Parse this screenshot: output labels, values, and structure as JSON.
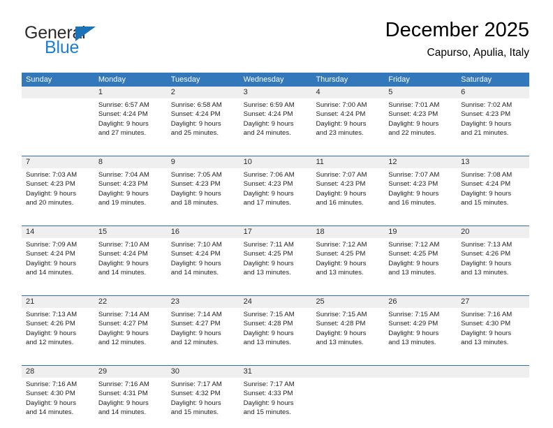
{
  "logo": {
    "word_top": "General",
    "word_bottom": "Blue",
    "triangle_color": "#1b72b8",
    "blue_text_color": "#1a7fd4"
  },
  "header": {
    "title": "December 2025",
    "subtitle": "Capurso, Apulia, Italy"
  },
  "theme": {
    "header_row_bg": "#3378bb",
    "week_divider": "#2f6fae",
    "day_number_bg": "#efefef"
  },
  "weekdays": [
    "Sunday",
    "Monday",
    "Tuesday",
    "Wednesday",
    "Thursday",
    "Friday",
    "Saturday"
  ],
  "weeks": [
    [
      {
        "day": "",
        "empty": true
      },
      {
        "day": "1",
        "sunrise": "Sunrise: 6:57 AM",
        "sunset": "Sunset: 4:24 PM",
        "daylight_1": "Daylight: 9 hours",
        "daylight_2": "and 27 minutes."
      },
      {
        "day": "2",
        "sunrise": "Sunrise: 6:58 AM",
        "sunset": "Sunset: 4:24 PM",
        "daylight_1": "Daylight: 9 hours",
        "daylight_2": "and 25 minutes."
      },
      {
        "day": "3",
        "sunrise": "Sunrise: 6:59 AM",
        "sunset": "Sunset: 4:24 PM",
        "daylight_1": "Daylight: 9 hours",
        "daylight_2": "and 24 minutes."
      },
      {
        "day": "4",
        "sunrise": "Sunrise: 7:00 AM",
        "sunset": "Sunset: 4:24 PM",
        "daylight_1": "Daylight: 9 hours",
        "daylight_2": "and 23 minutes."
      },
      {
        "day": "5",
        "sunrise": "Sunrise: 7:01 AM",
        "sunset": "Sunset: 4:23 PM",
        "daylight_1": "Daylight: 9 hours",
        "daylight_2": "and 22 minutes."
      },
      {
        "day": "6",
        "sunrise": "Sunrise: 7:02 AM",
        "sunset": "Sunset: 4:23 PM",
        "daylight_1": "Daylight: 9 hours",
        "daylight_2": "and 21 minutes."
      }
    ],
    [
      {
        "day": "7",
        "sunrise": "Sunrise: 7:03 AM",
        "sunset": "Sunset: 4:23 PM",
        "daylight_1": "Daylight: 9 hours",
        "daylight_2": "and 20 minutes."
      },
      {
        "day": "8",
        "sunrise": "Sunrise: 7:04 AM",
        "sunset": "Sunset: 4:23 PM",
        "daylight_1": "Daylight: 9 hours",
        "daylight_2": "and 19 minutes."
      },
      {
        "day": "9",
        "sunrise": "Sunrise: 7:05 AM",
        "sunset": "Sunset: 4:23 PM",
        "daylight_1": "Daylight: 9 hours",
        "daylight_2": "and 18 minutes."
      },
      {
        "day": "10",
        "sunrise": "Sunrise: 7:06 AM",
        "sunset": "Sunset: 4:23 PM",
        "daylight_1": "Daylight: 9 hours",
        "daylight_2": "and 17 minutes."
      },
      {
        "day": "11",
        "sunrise": "Sunrise: 7:07 AM",
        "sunset": "Sunset: 4:23 PM",
        "daylight_1": "Daylight: 9 hours",
        "daylight_2": "and 16 minutes."
      },
      {
        "day": "12",
        "sunrise": "Sunrise: 7:07 AM",
        "sunset": "Sunset: 4:23 PM",
        "daylight_1": "Daylight: 9 hours",
        "daylight_2": "and 16 minutes."
      },
      {
        "day": "13",
        "sunrise": "Sunrise: 7:08 AM",
        "sunset": "Sunset: 4:24 PM",
        "daylight_1": "Daylight: 9 hours",
        "daylight_2": "and 15 minutes."
      }
    ],
    [
      {
        "day": "14",
        "sunrise": "Sunrise: 7:09 AM",
        "sunset": "Sunset: 4:24 PM",
        "daylight_1": "Daylight: 9 hours",
        "daylight_2": "and 14 minutes."
      },
      {
        "day": "15",
        "sunrise": "Sunrise: 7:10 AM",
        "sunset": "Sunset: 4:24 PM",
        "daylight_1": "Daylight: 9 hours",
        "daylight_2": "and 14 minutes."
      },
      {
        "day": "16",
        "sunrise": "Sunrise: 7:10 AM",
        "sunset": "Sunset: 4:24 PM",
        "daylight_1": "Daylight: 9 hours",
        "daylight_2": "and 14 minutes."
      },
      {
        "day": "17",
        "sunrise": "Sunrise: 7:11 AM",
        "sunset": "Sunset: 4:25 PM",
        "daylight_1": "Daylight: 9 hours",
        "daylight_2": "and 13 minutes."
      },
      {
        "day": "18",
        "sunrise": "Sunrise: 7:12 AM",
        "sunset": "Sunset: 4:25 PM",
        "daylight_1": "Daylight: 9 hours",
        "daylight_2": "and 13 minutes."
      },
      {
        "day": "19",
        "sunrise": "Sunrise: 7:12 AM",
        "sunset": "Sunset: 4:25 PM",
        "daylight_1": "Daylight: 9 hours",
        "daylight_2": "and 13 minutes."
      },
      {
        "day": "20",
        "sunrise": "Sunrise: 7:13 AM",
        "sunset": "Sunset: 4:26 PM",
        "daylight_1": "Daylight: 9 hours",
        "daylight_2": "and 13 minutes."
      }
    ],
    [
      {
        "day": "21",
        "sunrise": "Sunrise: 7:13 AM",
        "sunset": "Sunset: 4:26 PM",
        "daylight_1": "Daylight: 9 hours",
        "daylight_2": "and 12 minutes."
      },
      {
        "day": "22",
        "sunrise": "Sunrise: 7:14 AM",
        "sunset": "Sunset: 4:27 PM",
        "daylight_1": "Daylight: 9 hours",
        "daylight_2": "and 12 minutes."
      },
      {
        "day": "23",
        "sunrise": "Sunrise: 7:14 AM",
        "sunset": "Sunset: 4:27 PM",
        "daylight_1": "Daylight: 9 hours",
        "daylight_2": "and 12 minutes."
      },
      {
        "day": "24",
        "sunrise": "Sunrise: 7:15 AM",
        "sunset": "Sunset: 4:28 PM",
        "daylight_1": "Daylight: 9 hours",
        "daylight_2": "and 13 minutes."
      },
      {
        "day": "25",
        "sunrise": "Sunrise: 7:15 AM",
        "sunset": "Sunset: 4:28 PM",
        "daylight_1": "Daylight: 9 hours",
        "daylight_2": "and 13 minutes."
      },
      {
        "day": "26",
        "sunrise": "Sunrise: 7:15 AM",
        "sunset": "Sunset: 4:29 PM",
        "daylight_1": "Daylight: 9 hours",
        "daylight_2": "and 13 minutes."
      },
      {
        "day": "27",
        "sunrise": "Sunrise: 7:16 AM",
        "sunset": "Sunset: 4:30 PM",
        "daylight_1": "Daylight: 9 hours",
        "daylight_2": "and 13 minutes."
      }
    ],
    [
      {
        "day": "28",
        "sunrise": "Sunrise: 7:16 AM",
        "sunset": "Sunset: 4:30 PM",
        "daylight_1": "Daylight: 9 hours",
        "daylight_2": "and 14 minutes."
      },
      {
        "day": "29",
        "sunrise": "Sunrise: 7:16 AM",
        "sunset": "Sunset: 4:31 PM",
        "daylight_1": "Daylight: 9 hours",
        "daylight_2": "and 14 minutes."
      },
      {
        "day": "30",
        "sunrise": "Sunrise: 7:17 AM",
        "sunset": "Sunset: 4:32 PM",
        "daylight_1": "Daylight: 9 hours",
        "daylight_2": "and 15 minutes."
      },
      {
        "day": "31",
        "sunrise": "Sunrise: 7:17 AM",
        "sunset": "Sunset: 4:33 PM",
        "daylight_1": "Daylight: 9 hours",
        "daylight_2": "and 15 minutes."
      },
      {
        "day": "",
        "empty": true
      },
      {
        "day": "",
        "empty": true
      },
      {
        "day": "",
        "empty": true
      }
    ]
  ]
}
